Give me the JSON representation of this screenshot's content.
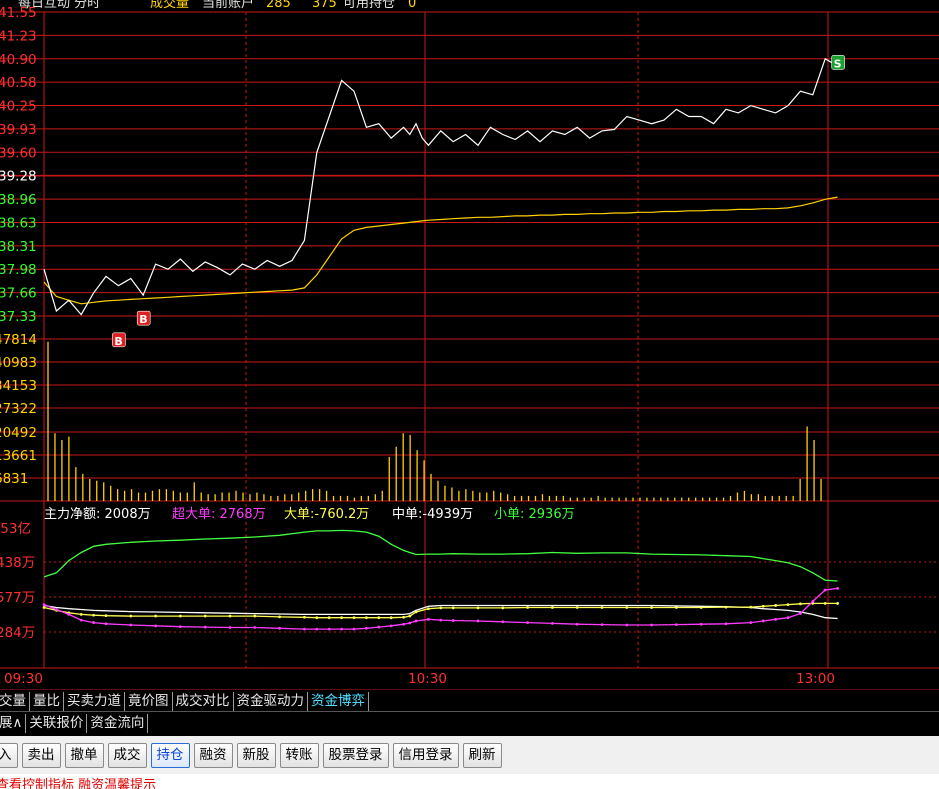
{
  "header": {
    "title": "每日互动  分时",
    "volume_label": "成交量",
    "account_label": "当前账户",
    "account_value": "285",
    "account_value2": "375",
    "position_label": "可用持仓",
    "position_value": "0"
  },
  "price_panel": {
    "y_labels": [
      "41.55",
      "41.23",
      "40.90",
      "40.58",
      "40.25",
      "39.93",
      "39.60",
      "39.28",
      "38.96",
      "38.63",
      "38.31",
      "37.98",
      "37.66",
      "37.33"
    ],
    "markers": [
      {
        "label": "B",
        "price": 37.3,
        "minute": 16,
        "color": "#e02020"
      },
      {
        "label": "B",
        "price": 37.0,
        "minute": 12,
        "color": "#e02020"
      },
      {
        "label": "S",
        "price": 40.85,
        "minute": 128,
        "color": "#18a030"
      }
    ]
  },
  "volume_panel": {
    "y_labels": [
      "47814",
      "40983",
      "34153",
      "27322",
      "20492",
      "13661",
      "6831"
    ]
  },
  "fund_panel": {
    "legend": [
      {
        "text": "主力净额: 2008万",
        "color": "#ffffff"
      },
      {
        "text": "超大单: 2768万",
        "color": "#ff3cff"
      },
      {
        "text": "大单:-760.2万",
        "color": "#ffff50"
      },
      {
        "text": "中单:-4939万",
        "color": "#ffffff"
      },
      {
        "text": "小单: 2936万",
        "color": "#40ff40"
      }
    ],
    "y_labels": [
      ".53亿",
      "438万",
      "577万",
      "284万"
    ]
  },
  "time_axis": {
    "labels": [
      {
        "text": "09:30",
        "minute": 0
      },
      {
        "text": "10:30",
        "minute": 60
      },
      {
        "text": "13:00",
        "minute": 120
      }
    ]
  },
  "chart_data": {
    "type": "line",
    "x_unit": "minutes since 09:30 session start",
    "price": {
      "ylim": [
        37.33,
        41.55
      ],
      "price_x": [
        0,
        2,
        4,
        6,
        8,
        10,
        12,
        14,
        16,
        18,
        20,
        22,
        24,
        26,
        28,
        30,
        32,
        34,
        36,
        38,
        40,
        42,
        44,
        46,
        48,
        50,
        52,
        54,
        56,
        58,
        59,
        60,
        61,
        62,
        64,
        66,
        68,
        70,
        72,
        74,
        76,
        78,
        80,
        82,
        84,
        86,
        88,
        90,
        92,
        94,
        96,
        98,
        100,
        102,
        104,
        106,
        108,
        110,
        112,
        114,
        116,
        118,
        120,
        122,
        124,
        126,
        128
      ],
      "price_values": [
        37.98,
        37.4,
        37.55,
        37.35,
        37.65,
        37.88,
        37.75,
        37.85,
        37.62,
        38.05,
        37.98,
        38.12,
        37.95,
        38.08,
        38.0,
        37.9,
        38.05,
        37.98,
        38.1,
        38.02,
        38.1,
        38.38,
        39.6,
        40.1,
        40.6,
        40.45,
        39.95,
        40.0,
        39.8,
        39.95,
        39.85,
        40.0,
        39.8,
        39.7,
        39.9,
        39.75,
        39.85,
        39.7,
        39.95,
        39.85,
        39.78,
        39.9,
        39.75,
        39.9,
        39.85,
        39.95,
        39.8,
        39.9,
        39.92,
        40.1,
        40.05,
        40.0,
        40.05,
        40.2,
        40.1,
        40.1,
        40.0,
        40.2,
        40.15,
        40.25,
        40.2,
        40.15,
        40.25,
        40.45,
        40.4,
        40.9,
        40.8
      ],
      "avg_values": [
        37.8,
        37.6,
        37.55,
        37.5,
        37.52,
        37.54,
        37.55,
        37.56,
        37.57,
        37.58,
        37.59,
        37.6,
        37.61,
        37.62,
        37.63,
        37.64,
        37.65,
        37.66,
        37.67,
        37.68,
        37.69,
        37.72,
        37.9,
        38.15,
        38.4,
        38.52,
        38.56,
        38.58,
        38.6,
        38.62,
        38.63,
        38.64,
        38.65,
        38.66,
        38.67,
        38.68,
        38.69,
        38.7,
        38.7,
        38.71,
        38.72,
        38.72,
        38.73,
        38.73,
        38.74,
        38.74,
        38.75,
        38.75,
        38.76,
        38.76,
        38.77,
        38.77,
        38.78,
        38.78,
        38.79,
        38.79,
        38.8,
        38.8,
        38.81,
        38.81,
        38.82,
        38.82,
        38.83,
        38.86,
        38.9,
        38.95,
        38.98
      ]
    },
    "volume": {
      "ylim": [
        0,
        47814
      ],
      "values": [
        47000,
        20000,
        18000,
        19000,
        10000,
        8000,
        6500,
        6000,
        5500,
        4500,
        3500,
        3000,
        3500,
        2500,
        2500,
        3000,
        3500,
        3500,
        3000,
        2500,
        2500,
        5500,
        2500,
        2000,
        2000,
        2500,
        2500,
        3000,
        2500,
        2000,
        2500,
        2000,
        1500,
        1500,
        2000,
        2000,
        2500,
        3000,
        3500,
        3500,
        3000,
        1500,
        1500,
        1500,
        1000,
        1500,
        1500,
        2000,
        3000,
        13000,
        16000,
        20000,
        19500,
        15000,
        12000,
        8000,
        6000,
        4500,
        4000,
        3000,
        3500,
        3000,
        2500,
        2500,
        3000,
        2500,
        2000,
        1500,
        1500,
        1500,
        1500,
        2000,
        1500,
        1500,
        1500,
        1000,
        1000,
        1000,
        1000,
        1500,
        1000,
        1000,
        1000,
        1000,
        1000,
        1000,
        1000,
        1000,
        1000,
        1000,
        1000,
        1000,
        1000,
        1000,
        1000,
        1000,
        1000,
        1000,
        1500,
        2500,
        3000,
        2000,
        2000,
        1500,
        1500,
        1500,
        1500,
        1500,
        6500,
        22000,
        18000,
        6500
      ]
    },
    "fund_flow": {
      "ylim": [
        -120,
        140
      ],
      "fund_x": [
        0,
        2,
        4,
        6,
        8,
        10,
        14,
        18,
        22,
        26,
        30,
        34,
        38,
        42,
        44,
        46,
        48,
        50,
        52,
        54,
        56,
        58,
        59,
        60,
        62,
        64,
        66,
        70,
        74,
        78,
        82,
        86,
        90,
        94,
        98,
        102,
        106,
        110,
        114,
        116,
        118,
        120,
        122,
        124,
        126,
        128
      ],
      "series": [
        {
          "name": "主力净额",
          "color": "#40ff40",
          "values": [
            20,
            30,
            60,
            80,
            95,
            100,
            105,
            108,
            110,
            113,
            115,
            118,
            122,
            130,
            133,
            133,
            134,
            133,
            130,
            120,
            100,
            85,
            80,
            75,
            76,
            76,
            77,
            76,
            76,
            77,
            80,
            78,
            79,
            79,
            76,
            75,
            74,
            72,
            70,
            65,
            60,
            55,
            45,
            30,
            12,
            10
          ]
        },
        {
          "name": "中单",
          "color": "#ffffff",
          "values": [
            -50,
            -55,
            -58,
            -60,
            -62,
            -63,
            -65,
            -66,
            -67,
            -68,
            -69,
            -70,
            -71,
            -72,
            -72,
            -72,
            -72,
            -72,
            -72,
            -72,
            -72,
            -72,
            -70,
            -62,
            -52,
            -50,
            -50,
            -50,
            -50,
            -50,
            -50,
            -50,
            -50,
            -50,
            -50,
            -51,
            -52,
            -53,
            -55,
            -58,
            -60,
            -62,
            -66,
            -72,
            -80,
            -82
          ]
        },
        {
          "name": "大单",
          "color": "#ffff50",
          "values": [
            -55,
            -62,
            -68,
            -72,
            -74,
            -75,
            -76,
            -76,
            -76,
            -76,
            -76,
            -76,
            -78,
            -79,
            -80,
            -80,
            -80,
            -80,
            -80,
            -80,
            -80,
            -79,
            -76,
            -66,
            -58,
            -56,
            -56,
            -56,
            -56,
            -55,
            -55,
            -55,
            -55,
            -55,
            -55,
            -55,
            -55,
            -54,
            -54,
            -52,
            -50,
            -48,
            -46,
            -45,
            -45,
            -45
          ]
        },
        {
          "name": "超大单",
          "color": "#ff3cff",
          "values": [
            -48,
            -60,
            -72,
            -86,
            -92,
            -95,
            -98,
            -100,
            -102,
            -103,
            -104,
            -104,
            -106,
            -108,
            -108,
            -108,
            -108,
            -108,
            -106,
            -103,
            -100,
            -96,
            -93,
            -88,
            -84,
            -86,
            -87,
            -88,
            -90,
            -92,
            -94,
            -96,
            -97,
            -98,
            -98,
            -97,
            -96,
            -95,
            -92,
            -88,
            -84,
            -80,
            -70,
            -40,
            -12,
            -8
          ]
        }
      ]
    }
  },
  "tabs_row1": [
    "交量",
    "量比",
    "买卖力道",
    "竟价图",
    "成交对比",
    "资金驱动力",
    "资金博弈"
  ],
  "tabs_row1_active": 6,
  "tabs_row2": [
    "展∧",
    "关联报价",
    "资金流向"
  ],
  "toolbar": {
    "buttons": [
      "入",
      "卖出",
      "撤单",
      "成交",
      "持仓",
      "融资",
      "新股",
      "转账",
      "股票登录",
      "信用登录",
      "刷新"
    ],
    "active_index": 4
  },
  "status": {
    "text": "查看控制指标  融资温馨提示"
  }
}
